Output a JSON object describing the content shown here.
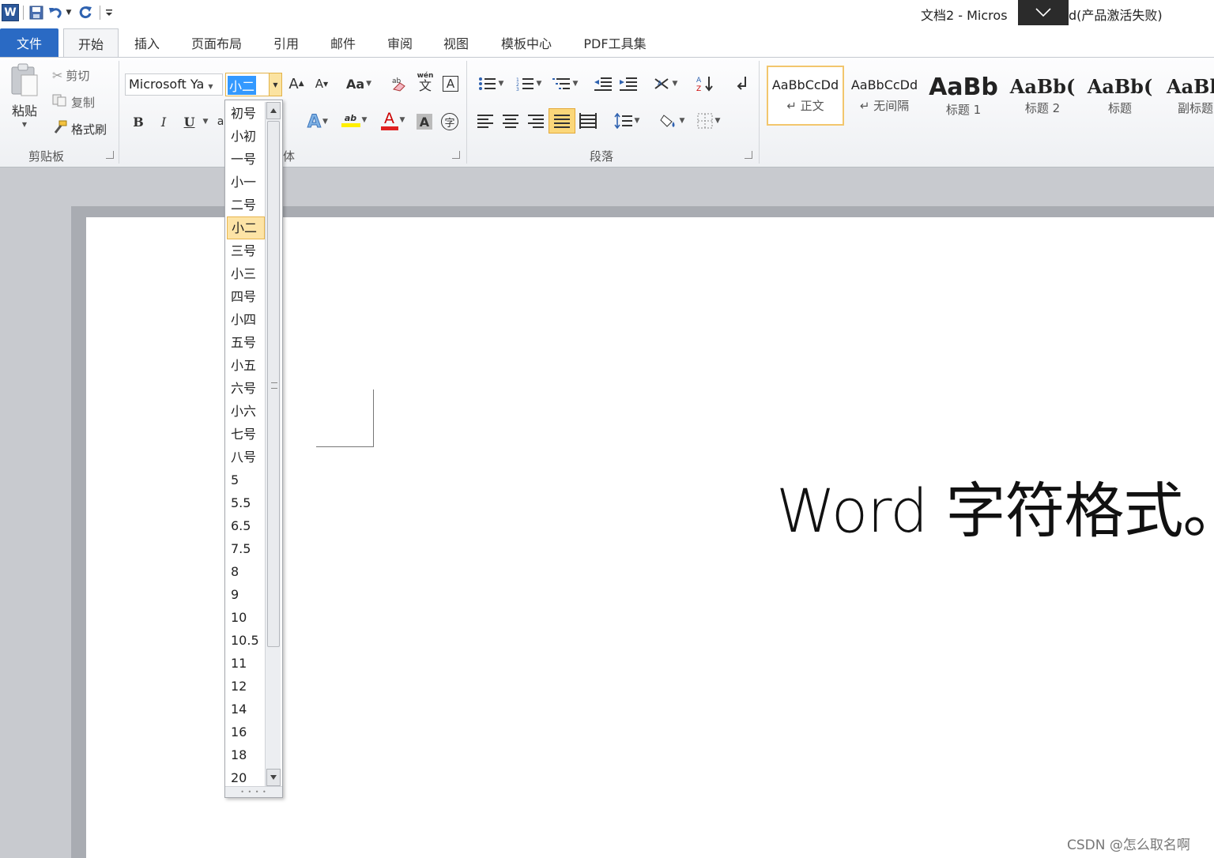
{
  "title": {
    "doc_name": "文档2 - Micros",
    "suffix": "d(产品激活失败)"
  },
  "qat": {
    "word_letter": "W"
  },
  "tabs": {
    "file": "文件",
    "items": [
      "开始",
      "插入",
      "页面布局",
      "引用",
      "邮件",
      "审阅",
      "视图",
      "模板中心",
      "PDF工具集"
    ]
  },
  "clipboard": {
    "paste": "粘贴",
    "cut": "剪切",
    "copy": "复制",
    "format_painter": "格式刷",
    "group_label": "剪贴板"
  },
  "font": {
    "font_name": "Microsoft Ya",
    "font_size": "小二",
    "group_label_partial": "体",
    "grow_label": "A",
    "shrink_label": "A",
    "case_label": "Aa",
    "bold": "B",
    "italic": "I",
    "underline": "U",
    "partial_a": "a",
    "phonetic": "wén",
    "phonetic_char": "文",
    "enclose_char": "字",
    "font_color_label": "A",
    "char_shading_label": "A",
    "highlight_label": "ab"
  },
  "paragraph": {
    "group_label": "段落"
  },
  "styles": [
    {
      "sample": "AaBbCcDd",
      "name": "↵ 正文",
      "selected": true
    },
    {
      "sample": "AaBbCcDd",
      "name": "↵ 无间隔",
      "selected": false
    },
    {
      "sample": "AaBb",
      "name": "标题 1",
      "selected": false
    },
    {
      "sample": "AaBb(",
      "name": "标题 2",
      "selected": false
    },
    {
      "sample": "AaBb(",
      "name": "标题",
      "selected": false
    },
    {
      "sample": "AaBl",
      "name": "副标题",
      "selected": false
    }
  ],
  "document": {
    "text": "Word 字符格式。"
  },
  "font_size_dropdown": {
    "items": [
      "初号",
      "小初",
      "一号",
      "小一",
      "二号",
      "小二",
      "三号",
      "小三",
      "四号",
      "小四",
      "五号",
      "小五",
      "六号",
      "小六",
      "七号",
      "八号",
      "5",
      "5.5",
      "6.5",
      "7.5",
      "8",
      "9",
      "10",
      "10.5",
      "11",
      "12",
      "14",
      "16",
      "18",
      "20"
    ],
    "selected": "小二"
  },
  "watermark": "CSDN @怎么取名啊",
  "colors": {
    "file_tab": "#2a6ac4",
    "selection_highlight": "#fde4a6",
    "selection_border": "#e8b64f",
    "text_selection": "#3399ff",
    "font_color_red": "#e02020",
    "highlight_yellow": "#ffef00"
  }
}
